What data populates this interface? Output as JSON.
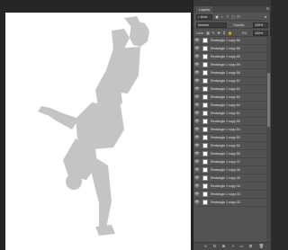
{
  "layers_panel": {
    "tab_label": "Layers",
    "menu_icon": "panel-menu-icon",
    "filter": {
      "kind_label": "Kind"
    },
    "blend": {
      "mode": "Normal",
      "opacity_label": "Opacity:",
      "opacity_value": "100%"
    },
    "lock": {
      "lock_label": "Lock:",
      "fill_label": "Fill:",
      "fill_value": "100%"
    },
    "layers": [
      {
        "name": "Rectangle 1 copy 66"
      },
      {
        "name": "Rectangle 1 copy 65"
      },
      {
        "name": "Rectangle 1 copy 60"
      },
      {
        "name": "Rectangle 1 copy 59"
      },
      {
        "name": "Rectangle 1 copy 58"
      },
      {
        "name": "Rectangle 1 copy 57"
      },
      {
        "name": "Rectangle 1 copy 62"
      },
      {
        "name": "Rectangle 1 copy 63"
      },
      {
        "name": "Rectangle 1 copy 64"
      },
      {
        "name": "Rectangle 1 copy 61"
      },
      {
        "name": "Rectangle 1 copy 56"
      },
      {
        "name": "Rectangle 1 copy 54"
      },
      {
        "name": "Rectangle 1 copy 53"
      },
      {
        "name": "Rectangle 1 copy 52"
      },
      {
        "name": "Rectangle 1 copy 55"
      },
      {
        "name": "Rectangle 1 copy 47"
      },
      {
        "name": "Rectangle 1 copy 48"
      },
      {
        "name": "Rectangle 1 copy 49"
      },
      {
        "name": "Rectangle 1 copy 44"
      },
      {
        "name": "Rectangle 1 copy 43"
      },
      {
        "name": "Rectangle 1 copy 42"
      }
    ]
  },
  "colors": {
    "panel_bg": "#535353",
    "canvas_bg": "#262626",
    "silhouette": "#c4c4c4"
  }
}
